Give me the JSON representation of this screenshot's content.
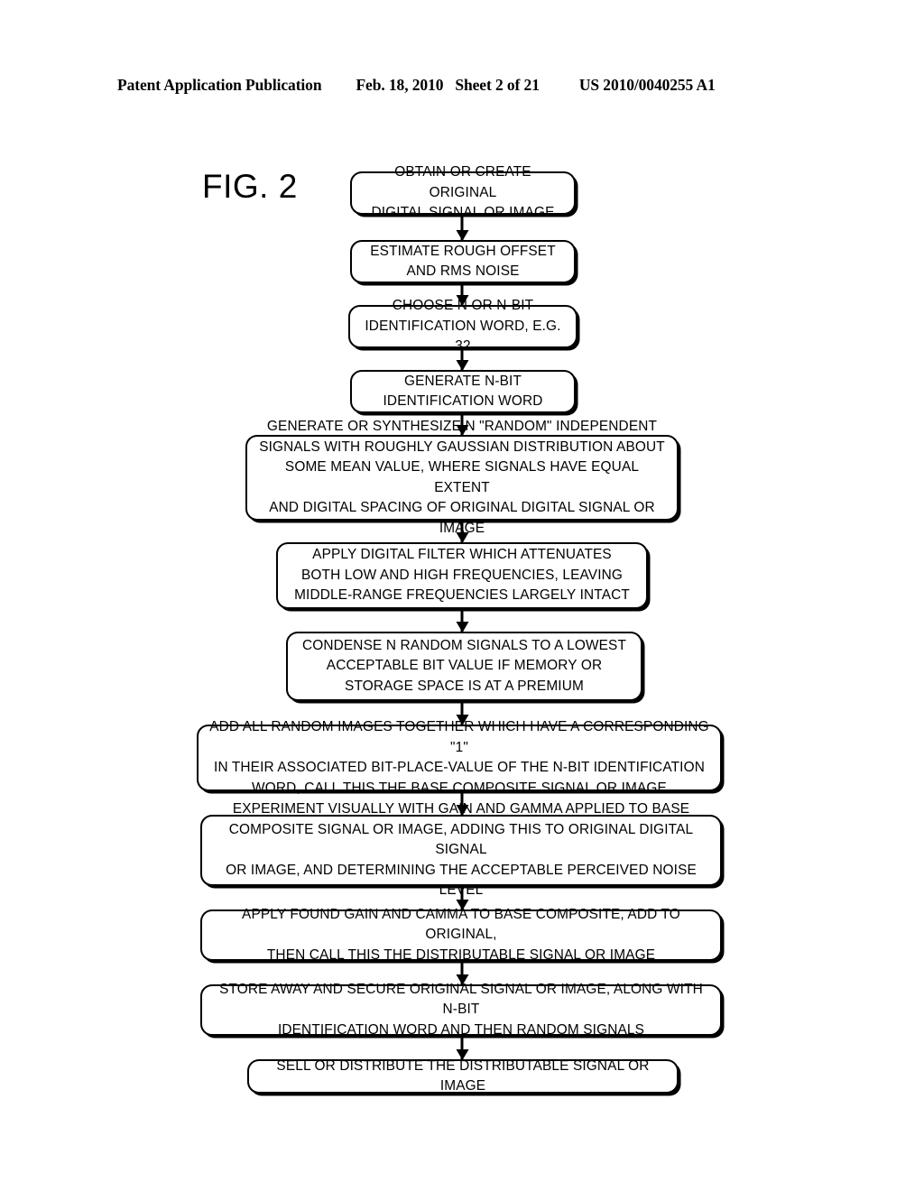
{
  "header": {
    "publication": "Patent Application Publication",
    "date": "Feb. 18, 2010",
    "sheet": "Sheet 2 of 21",
    "patent_number": "US 2010/0040255 A1"
  },
  "figure": {
    "label": "FIG. 2",
    "type": "flowchart",
    "orientation": "vertical-top-to-bottom",
    "connector": "arrow-down"
  },
  "flowchart": {
    "steps": [
      {
        "id": "step-1",
        "name": "obtain-or-create-original",
        "text": "OBTAIN OR CREATE ORIGINAL\nDIGITAL SIGNAL OR IMAGE"
      },
      {
        "id": "step-2",
        "name": "estimate-rough-offset",
        "text": "ESTIMATE ROUGH OFFSET\nAND RMS NOISE"
      },
      {
        "id": "step-3",
        "name": "choose-n-bit-word",
        "text": "CHOOSE N OR N-BIT\nIDENTIFICATION WORD, E.G. 32"
      },
      {
        "id": "step-4",
        "name": "generate-n-bit-word",
        "text": "GENERATE N-BIT\nIDENTIFICATION WORD"
      },
      {
        "id": "step-5",
        "name": "generate-random-signals",
        "text": "GENERATE OR SYNTHESIZE N \"RANDOM\" INDEPENDENT\nSIGNALS WITH ROUGHLY GAUSSIAN DISTRIBUTION ABOUT\nSOME MEAN VALUE, WHERE SIGNALS HAVE EQUAL EXTENT\nAND DIGITAL SPACING OF ORIGINAL DIGITAL SIGNAL OR IMAGE"
      },
      {
        "id": "step-6",
        "name": "apply-digital-filter",
        "text": "APPLY DIGITAL FILTER WHICH ATTENUATES\nBOTH LOW AND HIGH FREQUENCIES, LEAVING\nMIDDLE-RANGE FREQUENCIES LARGELY INTACT"
      },
      {
        "id": "step-7",
        "name": "condense-random-signals",
        "text": "CONDENSE N RANDOM SIGNALS TO A LOWEST\nACCEPTABLE BIT VALUE IF MEMORY OR\nSTORAGE SPACE IS AT A PREMIUM"
      },
      {
        "id": "step-8",
        "name": "add-random-images",
        "text": "ADD ALL RANDOM IMAGES TOGETHER WHICH HAVE A CORRESPONDING \"1\"\nIN THEIR ASSOCIATED BIT-PLACE-VALUE OF THE N-BIT IDENTIFICATION\nWORD, CALL THIS THE BASE COMPOSITE SIGNAL OR IMAGE"
      },
      {
        "id": "step-9",
        "name": "experiment-gain-gamma",
        "text": "EXPERIMENT VISUALLY WITH GAIN AND GAMMA APPLIED TO BASE\nCOMPOSITE SIGNAL OR IMAGE, ADDING THIS TO ORIGINAL DIGITAL SIGNAL\nOR IMAGE, AND DETERMINING THE ACCEPTABLE PERCEIVED NOISE LEVEL"
      },
      {
        "id": "step-10",
        "name": "apply-found-gain-gamma",
        "text": "APPLY FOUND GAIN AND CAMMA TO BASE COMPOSITE, ADD TO ORIGINAL,\nTHEN CALL THIS THE DISTRIBUTABLE SIGNAL OR IMAGE"
      },
      {
        "id": "step-11",
        "name": "store-away-and-secure",
        "text": "STORE AWAY AND SECURE ORIGINAL SIGNAL OR IMAGE, ALONG WITH N-BIT\nIDENTIFICATION WORD AND THEN RANDOM SIGNALS"
      },
      {
        "id": "step-12",
        "name": "sell-or-distribute",
        "text": "SELL OR DISTRIBUTE THE DISTRIBUTABLE SIGNAL OR IMAGE"
      }
    ]
  }
}
